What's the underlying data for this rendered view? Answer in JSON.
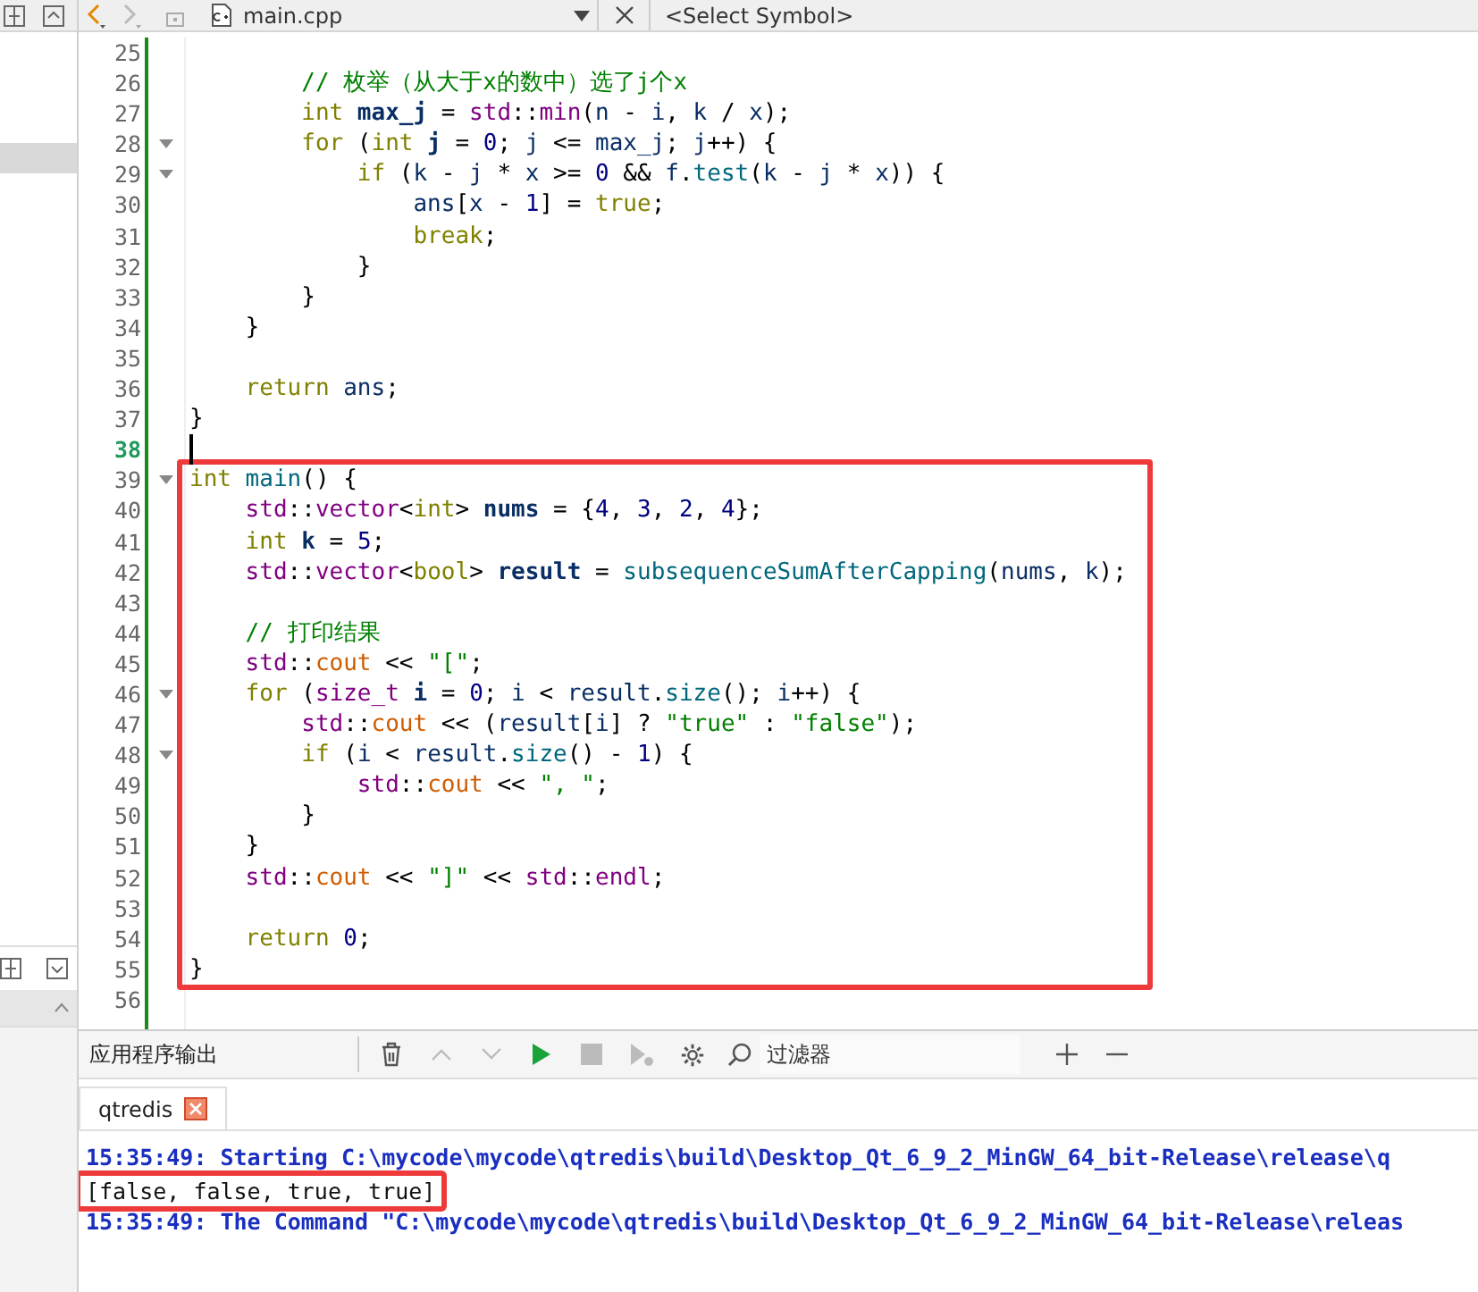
{
  "editor_toolbar": {
    "nav": [
      {
        "kind": "back",
        "disabled": false
      },
      {
        "kind": "forward",
        "disabled": true
      }
    ],
    "file_name": "main.cpp",
    "symbol_selector": "<Select Symbol>"
  },
  "code_sections": [
    {
      "lines": [
        {
          "number": "25"
        },
        {
          "number": "26",
          "tokens": [
            {
              "kind": "cm",
              "text": "        // 枚举（从大于x的数中）选了j个x"
            }
          ]
        },
        {
          "number": "27",
          "tokens": [
            {
              "kind": "kw",
              "text": "        int"
            },
            {
              "kind": "decl",
              "text": " max_j"
            },
            {
              "kind": "p",
              "text": " = "
            },
            {
              "kind": "ns",
              "text": "std"
            },
            {
              "kind": "p",
              "text": "::"
            },
            {
              "kind": "ty",
              "text": "min"
            },
            {
              "kind": "p",
              "text": "("
            },
            {
              "kind": "var",
              "text": "n"
            },
            {
              "kind": "p",
              "text": " - "
            },
            {
              "kind": "var",
              "text": "i"
            },
            {
              "kind": "p",
              "text": ", "
            },
            {
              "kind": "var",
              "text": "k"
            },
            {
              "kind": "p",
              "text": " / "
            },
            {
              "kind": "var",
              "text": "x"
            },
            {
              "kind": "p",
              "text": ");"
            }
          ]
        },
        {
          "number": "28",
          "foldable": true,
          "tokens": [
            {
              "kind": "kw",
              "text": "        for"
            },
            {
              "kind": "p",
              "text": " ("
            },
            {
              "kind": "kw",
              "text": "int"
            },
            {
              "kind": "decl",
              "text": " j"
            },
            {
              "kind": "p",
              "text": " = "
            },
            {
              "kind": "num",
              "text": "0"
            },
            {
              "kind": "p",
              "text": "; "
            },
            {
              "kind": "var",
              "text": "j"
            },
            {
              "kind": "p",
              "text": " <= "
            },
            {
              "kind": "var",
              "text": "max_j"
            },
            {
              "kind": "p",
              "text": "; "
            },
            {
              "kind": "var",
              "text": "j"
            },
            {
              "kind": "p",
              "text": "++) {"
            }
          ]
        },
        {
          "number": "29",
          "foldable": true,
          "tokens": [
            {
              "kind": "kw",
              "text": "            if"
            },
            {
              "kind": "p",
              "text": " ("
            },
            {
              "kind": "var",
              "text": "k"
            },
            {
              "kind": "p",
              "text": " - "
            },
            {
              "kind": "var",
              "text": "j"
            },
            {
              "kind": "p",
              "text": " * "
            },
            {
              "kind": "var",
              "text": "x"
            },
            {
              "kind": "p",
              "text": " >= "
            },
            {
              "kind": "num",
              "text": "0"
            },
            {
              "kind": "p",
              "text": " && "
            },
            {
              "kind": "var",
              "text": "f"
            },
            {
              "kind": "p",
              "text": "."
            },
            {
              "kind": "fn",
              "text": "test"
            },
            {
              "kind": "p",
              "text": "("
            },
            {
              "kind": "var",
              "text": "k"
            },
            {
              "kind": "p",
              "text": " - "
            },
            {
              "kind": "var",
              "text": "j"
            },
            {
              "kind": "p",
              "text": " * "
            },
            {
              "kind": "var",
              "text": "x"
            },
            {
              "kind": "p",
              "text": ")) {"
            }
          ]
        },
        {
          "number": "30",
          "tokens": [
            {
              "kind": "var",
              "text": "                ans"
            },
            {
              "kind": "p",
              "text": "["
            },
            {
              "kind": "var",
              "text": "x"
            },
            {
              "kind": "p",
              "text": " - "
            },
            {
              "kind": "num",
              "text": "1"
            },
            {
              "kind": "p",
              "text": "] = "
            },
            {
              "kind": "kw",
              "text": "true"
            },
            {
              "kind": "p",
              "text": ";"
            }
          ]
        },
        {
          "number": "31",
          "tokens": [
            {
              "kind": "kw",
              "text": "                break"
            },
            {
              "kind": "p",
              "text": ";"
            }
          ]
        },
        {
          "number": "32",
          "tokens": [
            {
              "kind": "p",
              "text": "            }"
            }
          ]
        },
        {
          "number": "33",
          "tokens": [
            {
              "kind": "p",
              "text": "        }"
            }
          ]
        },
        {
          "number": "34",
          "tokens": [
            {
              "kind": "p",
              "text": "    }"
            }
          ]
        },
        {
          "number": "35"
        },
        {
          "number": "36",
          "tokens": [
            {
              "kind": "kw",
              "text": "    return"
            },
            {
              "kind": "var",
              "text": " ans"
            },
            {
              "kind": "p",
              "text": ";"
            }
          ]
        },
        {
          "number": "37",
          "tokens": [
            {
              "kind": "p",
              "text": "}"
            }
          ]
        },
        {
          "number": "38",
          "current": true
        }
      ]
    },
    {
      "boxed": true,
      "lines": [
        {
          "number": "39",
          "foldable": true,
          "tokens": [
            {
              "kind": "kw",
              "text": "int"
            },
            {
              "kind": "fn",
              "text": " main"
            },
            {
              "kind": "p",
              "text": "() {"
            }
          ]
        },
        {
          "number": "40",
          "tokens": [
            {
              "kind": "ns",
              "text": "    std"
            },
            {
              "kind": "p",
              "text": "::"
            },
            {
              "kind": "ty",
              "text": "vector"
            },
            {
              "kind": "p",
              "text": "<"
            },
            {
              "kind": "kw",
              "text": "int"
            },
            {
              "kind": "p",
              "text": ">"
            },
            {
              "kind": "decl",
              "text": " nums"
            },
            {
              "kind": "p",
              "text": " = {"
            },
            {
              "kind": "num",
              "text": "4"
            },
            {
              "kind": "p",
              "text": ", "
            },
            {
              "kind": "num",
              "text": "3"
            },
            {
              "kind": "p",
              "text": ", "
            },
            {
              "kind": "num",
              "text": "2"
            },
            {
              "kind": "p",
              "text": ", "
            },
            {
              "kind": "num",
              "text": "4"
            },
            {
              "kind": "p",
              "text": "};"
            }
          ]
        },
        {
          "number": "41",
          "tokens": [
            {
              "kind": "kw",
              "text": "    int"
            },
            {
              "kind": "decl",
              "text": " k"
            },
            {
              "kind": "p",
              "text": " = "
            },
            {
              "kind": "num",
              "text": "5"
            },
            {
              "kind": "p",
              "text": ";"
            }
          ]
        },
        {
          "number": "42",
          "tokens": [
            {
              "kind": "ns",
              "text": "    std"
            },
            {
              "kind": "p",
              "text": "::"
            },
            {
              "kind": "ty",
              "text": "vector"
            },
            {
              "kind": "p",
              "text": "<"
            },
            {
              "kind": "kw",
              "text": "bool"
            },
            {
              "kind": "p",
              "text": ">"
            },
            {
              "kind": "decl",
              "text": " result"
            },
            {
              "kind": "p",
              "text": " = "
            },
            {
              "kind": "fn",
              "text": "subsequenceSumAfterCapping"
            },
            {
              "kind": "p",
              "text": "("
            },
            {
              "kind": "var",
              "text": "nums"
            },
            {
              "kind": "p",
              "text": ", "
            },
            {
              "kind": "var",
              "text": "k"
            },
            {
              "kind": "p",
              "text": ");"
            }
          ]
        },
        {
          "number": "43"
        },
        {
          "number": "44",
          "tokens": [
            {
              "kind": "cm",
              "text": "    // 打印结果"
            }
          ]
        },
        {
          "number": "45",
          "tokens": [
            {
              "kind": "ns",
              "text": "    std"
            },
            {
              "kind": "p",
              "text": "::"
            },
            {
              "kind": "out",
              "text": "cout"
            },
            {
              "kind": "p",
              "text": " << "
            },
            {
              "kind": "str",
              "text": "\"[\""
            },
            {
              "kind": "p",
              "text": ";"
            }
          ]
        },
        {
          "number": "46",
          "foldable": true,
          "tokens": [
            {
              "kind": "kw",
              "text": "    for"
            },
            {
              "kind": "p",
              "text": " ("
            },
            {
              "kind": "ty",
              "text": "size_t"
            },
            {
              "kind": "decl",
              "text": " i"
            },
            {
              "kind": "p",
              "text": " = "
            },
            {
              "kind": "num",
              "text": "0"
            },
            {
              "kind": "p",
              "text": "; "
            },
            {
              "kind": "var",
              "text": "i"
            },
            {
              "kind": "p",
              "text": " < "
            },
            {
              "kind": "var",
              "text": "result"
            },
            {
              "kind": "p",
              "text": "."
            },
            {
              "kind": "fn",
              "text": "size"
            },
            {
              "kind": "p",
              "text": "(); "
            },
            {
              "kind": "var",
              "text": "i"
            },
            {
              "kind": "p",
              "text": "++) {"
            }
          ]
        },
        {
          "number": "47",
          "tokens": [
            {
              "kind": "ns",
              "text": "        std"
            },
            {
              "kind": "p",
              "text": "::"
            },
            {
              "kind": "out",
              "text": "cout"
            },
            {
              "kind": "p",
              "text": " << ("
            },
            {
              "kind": "var",
              "text": "result"
            },
            {
              "kind": "p",
              "text": "["
            },
            {
              "kind": "var",
              "text": "i"
            },
            {
              "kind": "p",
              "text": "] ? "
            },
            {
              "kind": "str",
              "text": "\"true\""
            },
            {
              "kind": "p",
              "text": " : "
            },
            {
              "kind": "str",
              "text": "\"false\""
            },
            {
              "kind": "p",
              "text": ");"
            }
          ]
        },
        {
          "number": "48",
          "foldable": true,
          "tokens": [
            {
              "kind": "kw",
              "text": "        if"
            },
            {
              "kind": "p",
              "text": " ("
            },
            {
              "kind": "var",
              "text": "i"
            },
            {
              "kind": "p",
              "text": " < "
            },
            {
              "kind": "var",
              "text": "result"
            },
            {
              "kind": "p",
              "text": "."
            },
            {
              "kind": "fn",
              "text": "size"
            },
            {
              "kind": "p",
              "text": "() - "
            },
            {
              "kind": "num",
              "text": "1"
            },
            {
              "kind": "p",
              "text": ") {"
            }
          ]
        },
        {
          "number": "49",
          "tokens": [
            {
              "kind": "ns",
              "text": "            std"
            },
            {
              "kind": "p",
              "text": "::"
            },
            {
              "kind": "out",
              "text": "cout"
            },
            {
              "kind": "p",
              "text": " << "
            },
            {
              "kind": "str",
              "text": "\", \""
            },
            {
              "kind": "p",
              "text": ";"
            }
          ]
        },
        {
          "number": "50",
          "tokens": [
            {
              "kind": "p",
              "text": "        }"
            }
          ]
        },
        {
          "number": "51",
          "tokens": [
            {
              "kind": "p",
              "text": "    }"
            }
          ]
        },
        {
          "number": "52",
          "tokens": [
            {
              "kind": "ns",
              "text": "    std"
            },
            {
              "kind": "p",
              "text": "::"
            },
            {
              "kind": "out",
              "text": "cout"
            },
            {
              "kind": "p",
              "text": " << "
            },
            {
              "kind": "str",
              "text": "\"]\""
            },
            {
              "kind": "p",
              "text": " << "
            },
            {
              "kind": "ns",
              "text": "std"
            },
            {
              "kind": "p",
              "text": "::"
            },
            {
              "kind": "ty",
              "text": "endl"
            },
            {
              "kind": "p",
              "text": ";"
            }
          ]
        },
        {
          "number": "53"
        },
        {
          "number": "54",
          "tokens": [
            {
              "kind": "kw",
              "text": "    return"
            },
            {
              "kind": "num",
              "text": " 0"
            },
            {
              "kind": "p",
              "text": ";"
            }
          ]
        },
        {
          "number": "55",
          "tokens": [
            {
              "kind": "p",
              "text": "}"
            }
          ]
        }
      ]
    },
    {
      "lines": [
        {
          "number": "56"
        }
      ]
    }
  ],
  "output_panel": {
    "title": "应用程序输出",
    "tools": [
      {
        "kind": "trash",
        "disabled": false
      },
      {
        "kind": "up",
        "disabled": true
      },
      {
        "kind": "down",
        "disabled": true
      },
      {
        "kind": "run",
        "disabled": false
      },
      {
        "kind": "stop",
        "disabled": true
      },
      {
        "kind": "debug",
        "disabled": true
      },
      {
        "kind": "settings",
        "disabled": false
      }
    ],
    "filter_placeholder": "过滤器",
    "tabs": [
      {
        "label": "qtredis",
        "selected": true
      }
    ],
    "lines": [
      {
        "kind": "system",
        "boxed": false,
        "text": "15:35:49: Starting C:\\mycode\\mycode\\qtredis\\build\\Desktop_Qt_6_9_2_MinGW_64_bit-Release\\release\\q"
      },
      {
        "kind": "stdout",
        "boxed": true,
        "text": "[false, false, true, true]"
      },
      {
        "kind": "system",
        "boxed": false,
        "text": "15:35:49: The Command \"C:\\mycode\\mycode\\qtredis\\build\\Desktop_Qt_6_9_2_MinGW_64_bit-Release\\releas"
      }
    ]
  }
}
